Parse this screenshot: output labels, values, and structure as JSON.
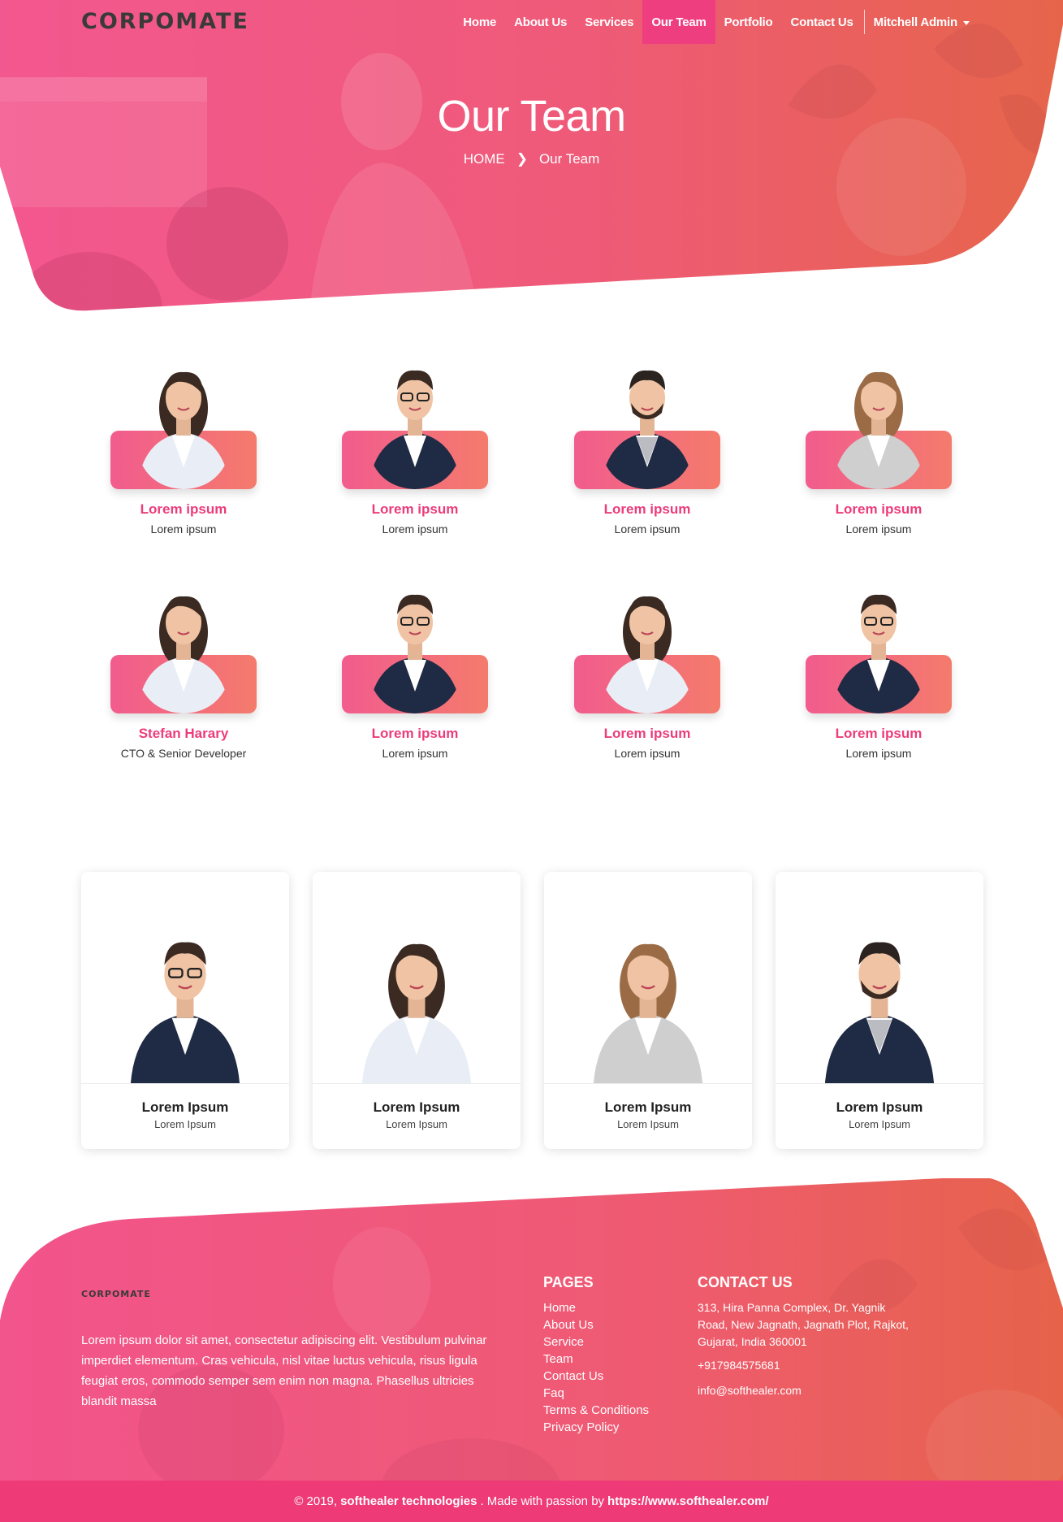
{
  "brand": {
    "logo": "CORPOMATE"
  },
  "nav": {
    "items": [
      {
        "label": "Home"
      },
      {
        "label": "About Us"
      },
      {
        "label": "Services"
      },
      {
        "label": "Our Team",
        "active": true
      },
      {
        "label": "Portfolio"
      },
      {
        "label": "Contact Us"
      }
    ],
    "user": "Mitchell Admin"
  },
  "hero": {
    "title": "Our Team",
    "breadcrumb_home": "HOME",
    "breadcrumb_current": "Our Team"
  },
  "team": [
    {
      "name": "Lorem ipsum",
      "role": "Lorem ipsum"
    },
    {
      "name": "Lorem ipsum",
      "role": "Lorem ipsum"
    },
    {
      "name": "Lorem ipsum",
      "role": "Lorem ipsum"
    },
    {
      "name": "Lorem ipsum",
      "role": "Lorem ipsum"
    },
    {
      "name": "Stefan Harary",
      "role": "CTO & Senior Developer"
    },
    {
      "name": "Lorem ipsum",
      "role": "Lorem ipsum"
    },
    {
      "name": "Lorem ipsum",
      "role": "Lorem ipsum"
    },
    {
      "name": "Lorem ipsum",
      "role": "Lorem ipsum"
    }
  ],
  "cards": [
    {
      "name": "Lorem Ipsum",
      "role": "Lorem Ipsum"
    },
    {
      "name": "Lorem Ipsum",
      "role": "Lorem Ipsum"
    },
    {
      "name": "Lorem Ipsum",
      "role": "Lorem Ipsum"
    },
    {
      "name": "Lorem Ipsum",
      "role": "Lorem Ipsum"
    }
  ],
  "footer": {
    "logo": "CORPOMATE",
    "about": "Lorem ipsum dolor sit amet, consectetur adipiscing elit. Vestibulum pulvinar imperdiet elementum. Cras vehicula, nisl vitae luctus vehicula, risus ligula feugiat eros, commodo semper sem enim non magna. Phasellus ultricies blandit massa",
    "pages_title": "PAGES",
    "pages": [
      "Home",
      "About Us",
      "Service",
      "Team",
      "Contact Us",
      "Faq",
      "Terms & Conditions",
      "Privacy Policy"
    ],
    "contact_title": "CONTACT US",
    "address": "313, Hira Panna Complex, Dr. Yagnik Road, New Jagnath, Jagnath Plot, Rajkot, Gujarat, India 360001",
    "phone": "+917984575681",
    "email": "info@softhealer.com"
  },
  "copyright": {
    "prefix": "© 2019,",
    "company": "softhealer technologies",
    "middle": ". Made with passion by",
    "url": "https://www.softhealer.com/"
  },
  "colors": {
    "accent": "#ee3e80",
    "gradient_start": "#f0508a",
    "gradient_end": "#e8614e",
    "name_pink": "#ec3c7a"
  }
}
